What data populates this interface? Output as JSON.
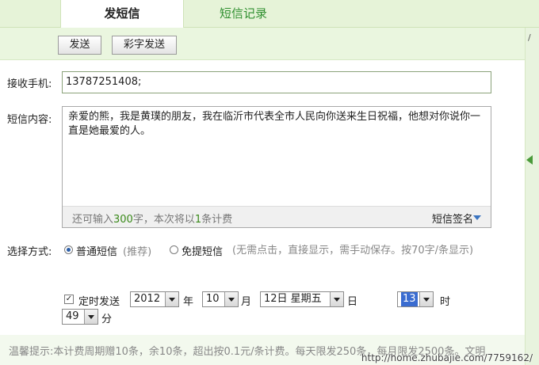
{
  "tabs": [
    {
      "label": "发短信",
      "active": true
    },
    {
      "label": "短信记录",
      "active": false
    }
  ],
  "toolbar": {
    "send_label": "发送",
    "color_send_label": "彩字发送"
  },
  "side_rail": {
    "mark": "/"
  },
  "form": {
    "phone_label": "接收手机:",
    "phone_value": "13787251408;",
    "content_label": "短信内容:",
    "content_text": "亲爱的熊，我是黄璞的朋友，我在临沂市代表全市人民向你送来生日祝福，他想对你说你一直是她最爱的人。",
    "remain": {
      "prefix": "还可输入",
      "chars": "300",
      "mid": "字，本次将以",
      "count": "1",
      "suffix": "条计费"
    },
    "signature_label": "短信签名",
    "mode_label": "选择方式:",
    "mode_normal": "普通短信",
    "mode_normal_note": "(推荐)",
    "mode_flash": "免提短信",
    "mode_flash_note": "(无需点击，直接显示，需手动保存。按70字/条显示)",
    "mode_flash_note_cont": "示)",
    "schedule": {
      "label": "定时发送",
      "checked": true,
      "year": "2012",
      "year_unit": "年",
      "month": "10",
      "month_unit": "月",
      "day": "12日 星期五",
      "day_unit": "日",
      "hour": "13",
      "hour_unit": "时",
      "minute": "49",
      "minute_unit": "分"
    }
  },
  "tips": {
    "text": "温馨提示:本计费周期赠10条，余10条，超出按0.1元/条计费。每天限发250条，每月限发2500条。文明"
  },
  "watermark": {
    "text": "http://home.zhubajie.com/7759162/"
  },
  "colors": {
    "accent_green": "#2f8f2f",
    "tab_bg": "#e6f3d8",
    "highlight_blue": "#3a6cd0"
  }
}
